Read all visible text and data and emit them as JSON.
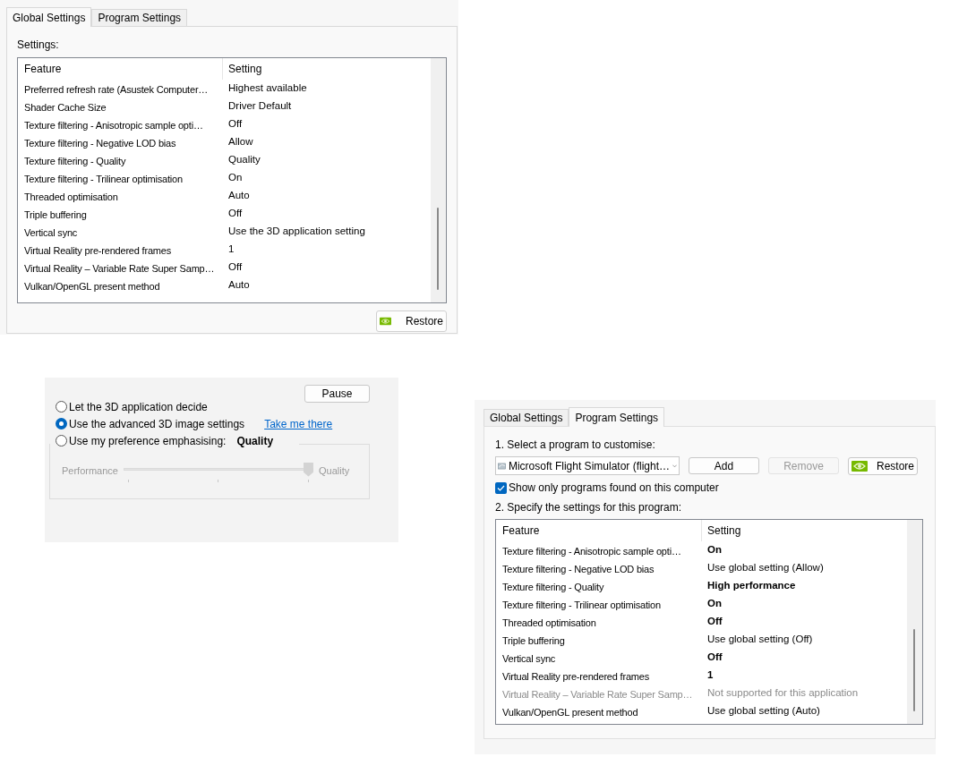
{
  "global_panel": {
    "tabs": [
      {
        "label": "Global Settings",
        "selected": true
      },
      {
        "label": "Program Settings",
        "selected": false
      }
    ],
    "settings_label": "Settings:",
    "table": {
      "columns": [
        "Feature",
        "Setting"
      ],
      "rows": [
        {
          "feature": "Preferred refresh rate (Asustek Computer…",
          "setting": "Highest available"
        },
        {
          "feature": "Shader Cache Size",
          "setting": "Driver Default"
        },
        {
          "feature": "Texture filtering - Anisotropic sample opti…",
          "setting": "Off"
        },
        {
          "feature": "Texture filtering - Negative LOD bias",
          "setting": "Allow"
        },
        {
          "feature": "Texture filtering - Quality",
          "setting": "Quality"
        },
        {
          "feature": "Texture filtering - Trilinear optimisation",
          "setting": "On"
        },
        {
          "feature": "Threaded optimisation",
          "setting": "Auto"
        },
        {
          "feature": "Triple buffering",
          "setting": "Off"
        },
        {
          "feature": "Vertical sync",
          "setting": "Use the 3D application setting"
        },
        {
          "feature": "Virtual Reality pre-rendered frames",
          "setting": "1"
        },
        {
          "feature": "Virtual Reality – Variable Rate Super Samp…",
          "setting": "Off"
        },
        {
          "feature": "Vulkan/OpenGL present method",
          "setting": "Auto"
        }
      ]
    },
    "restore_button": "Restore"
  },
  "image_panel": {
    "pause_button": "Pause",
    "options": [
      {
        "label": "Let the 3D application decide",
        "selected": false
      },
      {
        "label": "Use the advanced 3D image settings",
        "selected": true,
        "link": "Take me there"
      },
      {
        "label": "Use my preference emphasising:",
        "selected": false,
        "value": "Quality"
      }
    ],
    "slider": {
      "left_label": "Performance",
      "right_label": "Quality",
      "level": 1.0,
      "disabled": true
    }
  },
  "program_panel": {
    "tabs": [
      {
        "label": "Global Settings",
        "selected": false
      },
      {
        "label": "Program Settings",
        "selected": true
      }
    ],
    "step1": "1. Select a program to customise:",
    "program": "Microsoft Flight Simulator (flight…",
    "buttons": [
      {
        "label": "Add",
        "kind": "plain",
        "disabled": false
      },
      {
        "label": "Remove",
        "kind": "plain",
        "disabled": true
      },
      {
        "label": "Restore",
        "kind": "restore",
        "disabled": false
      }
    ],
    "show_only": {
      "label": "Show only programs found on this computer",
      "checked": true
    },
    "step2": "2. Specify the settings for this program:",
    "table": {
      "columns": [
        "Feature",
        "Setting"
      ],
      "rows": [
        {
          "feature": "Texture filtering - Anisotropic sample opti…",
          "setting": "On",
          "kind": "custom"
        },
        {
          "feature": "Texture filtering - Negative LOD bias",
          "setting": "Use global setting (Allow)",
          "kind": "global"
        },
        {
          "feature": "Texture filtering - Quality",
          "setting": "High performance",
          "kind": "custom"
        },
        {
          "feature": "Texture filtering - Trilinear optimisation",
          "setting": "On",
          "kind": "custom"
        },
        {
          "feature": "Threaded optimisation",
          "setting": "Off",
          "kind": "custom"
        },
        {
          "feature": "Triple buffering",
          "setting": "Use global setting (Off)",
          "kind": "global"
        },
        {
          "feature": "Vertical sync",
          "setting": "Off",
          "kind": "custom"
        },
        {
          "feature": "Virtual Reality pre-rendered frames",
          "setting": "1",
          "kind": "custom"
        },
        {
          "feature": "Virtual Reality – Variable Rate Super Samp…",
          "setting": "Not supported for this application",
          "kind": "unsupported"
        },
        {
          "feature": "Vulkan/OpenGL present method",
          "setting": "Use global setting (Auto)",
          "kind": "global"
        }
      ]
    }
  }
}
